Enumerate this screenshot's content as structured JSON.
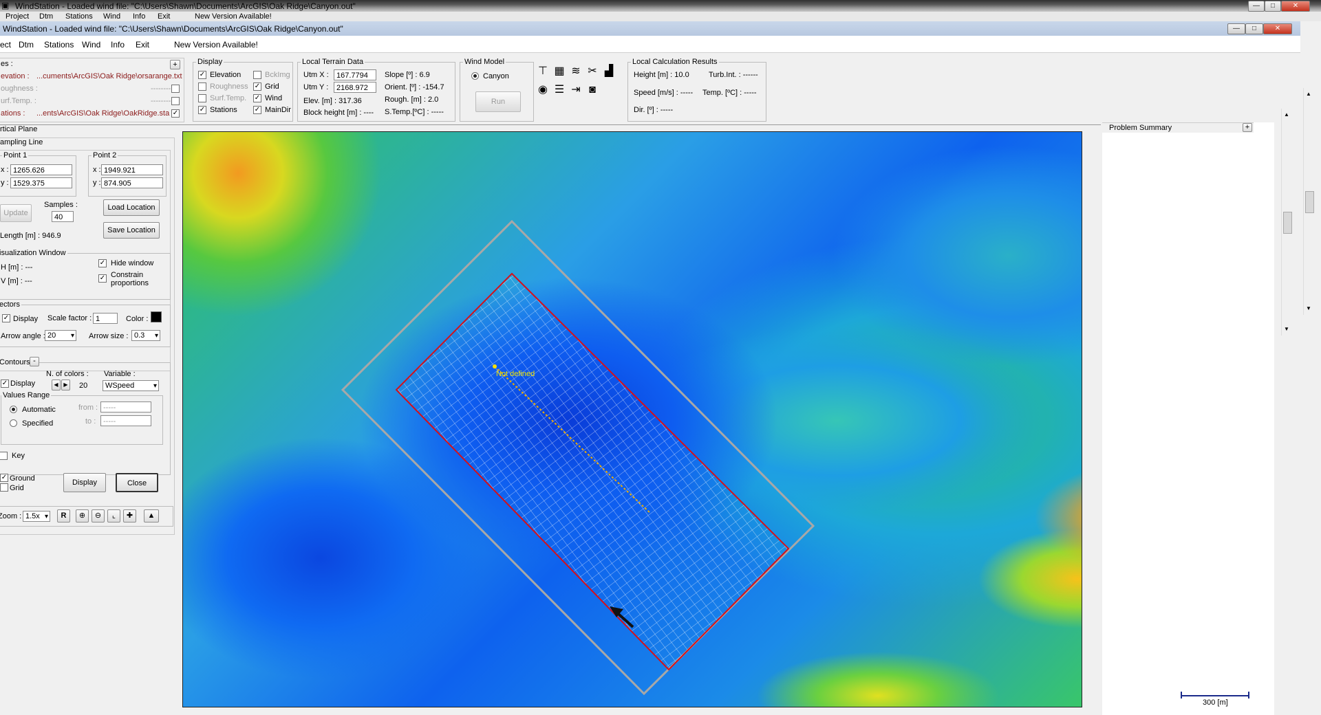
{
  "bg_window": {
    "title": "WindStation - Loaded wind file:  \"C:\\Users\\Shawn\\Documents\\ArcGIS\\Oak Ridge\\Canyon.out\"",
    "menu": [
      "Project",
      "Dtm",
      "Stations",
      "Wind",
      "Info",
      "Exit",
      "New Version Available!"
    ]
  },
  "window": {
    "title": "WindStation - Loaded wind file:  \"C:\\Users\\Shawn\\Documents\\ArcGIS\\Oak Ridge\\Canyon.out\"",
    "menu": [
      "Project",
      "Dtm",
      "Stations",
      "Wind",
      "Info",
      "Exit",
      "New Version Available!"
    ],
    "controls": {
      "minimize": "—",
      "maximize": "□",
      "close": "✕"
    }
  },
  "files": {
    "title": "Files :",
    "plus": "+",
    "rows": [
      {
        "label": "Elevation :",
        "value": "...cuments\\ArcGIS\\Oak Ridge\\orsarange.txt",
        "checked": false,
        "active": true
      },
      {
        "label": "Roughness :",
        "value": "--------",
        "checked": false,
        "active": false
      },
      {
        "label": "Surf.Temp. :",
        "value": "--------",
        "checked": false,
        "active": false
      },
      {
        "label": "Stations :",
        "value": "...ents\\ArcGIS\\Oak Ridge\\OakRidge.sta",
        "checked": true,
        "active": true
      }
    ]
  },
  "display": {
    "title": "Display",
    "items": [
      {
        "label": "Elevation",
        "checked": true,
        "enabled": true
      },
      {
        "label": "BckImg",
        "checked": false,
        "enabled": false
      },
      {
        "label": "Roughness",
        "checked": false,
        "enabled": false
      },
      {
        "label": "Grid",
        "checked": true,
        "enabled": true
      },
      {
        "label": "Surf.Temp.",
        "checked": false,
        "enabled": false
      },
      {
        "label": "Wind",
        "checked": true,
        "enabled": true
      },
      {
        "label": "Stations",
        "checked": true,
        "enabled": true
      },
      {
        "label": "MainDir",
        "checked": true,
        "enabled": true
      }
    ]
  },
  "terrain": {
    "title": "Local Terrain Data",
    "utmx_label": "Utm X :",
    "utmx": "167.7794",
    "utmy_label": "Utm Y :",
    "utmy": "2168.972",
    "elev": "Elev. [m] : 317.36",
    "block": "Block height [m] : ----",
    "slope": "Slope [º] : 6.9",
    "orient": "Orient. [º] : -154.7",
    "rough": "Rough. [m] : 2.0",
    "stemp": "S.Temp.[ºC] : -----"
  },
  "wind_model": {
    "title": "Wind Model",
    "option": "Canyon",
    "run": "Run"
  },
  "results": {
    "title": "Local Calculation Results",
    "height": "Height [m] : 10.0",
    "turb": "Turb.Int. : ------",
    "speed": "Speed [m/s] : -----",
    "temp": "Temp. [ºC] : -----",
    "dir": "Dir. [º] : -----"
  },
  "vertical_plane": {
    "title": "Vertical Plane",
    "sampling_title": "Sampling Line",
    "point1_title": "Point 1",
    "point1_x": "1265.626",
    "point1_y": "1529.375",
    "point2_title": "Point 2",
    "point2_x": "1949.921",
    "point2_y": "874.905",
    "x_label": "x :",
    "y_label": "y :",
    "update": "Update",
    "samples_label": "Samples :",
    "samples": "40",
    "load_location": "Load Location",
    "save_location": "Save Location",
    "length": "Length [m] : 946.9",
    "vis_title": "Visualization Window",
    "h": "H [m] : ---",
    "v": "V [m] : ---",
    "hide_window": "Hide window",
    "constrain": "Constrain",
    "proportions": "proportions",
    "vectors_title": "Vectors",
    "display": "Display",
    "scale_label": "Scale factor :",
    "scale": "1",
    "color_label": "Color :",
    "arrow_angle_label": "Arrow angle :",
    "arrow_angle": "20",
    "arrow_size_label": "Arrow size :",
    "arrow_size": "0.3",
    "contours_title": "Contours",
    "contours_btn": "-",
    "ncolors_label": "N. of colors :",
    "ncolors": "20",
    "variable_label": "Variable :",
    "variable": "WSpeed",
    "contour_display": "Display",
    "values_range": "Values Range",
    "automatic": "Automatic",
    "specified": "Specified",
    "from_label": "from :",
    "from": "-----",
    "to_label": "to :",
    "to": "-----",
    "key": "Key",
    "ground": "Ground",
    "grid": "Grid",
    "display_btn": "Display",
    "close_btn": "Close"
  },
  "zoom": {
    "label": "Zoom :",
    "value": "1.5x",
    "buttons": [
      "R",
      "zoom-in",
      "zoom-out",
      "zoom-extent",
      "pan",
      "profile"
    ]
  },
  "map": {
    "point_label": "Not defined",
    "scale_label": "300 [m]",
    "colors": {
      "red_box": "#d4101a",
      "outer_box": "#a8a8a8",
      "grid": "#ffffff"
    }
  },
  "problem_summary": {
    "title": "Problem Summary",
    "plus": "+"
  }
}
